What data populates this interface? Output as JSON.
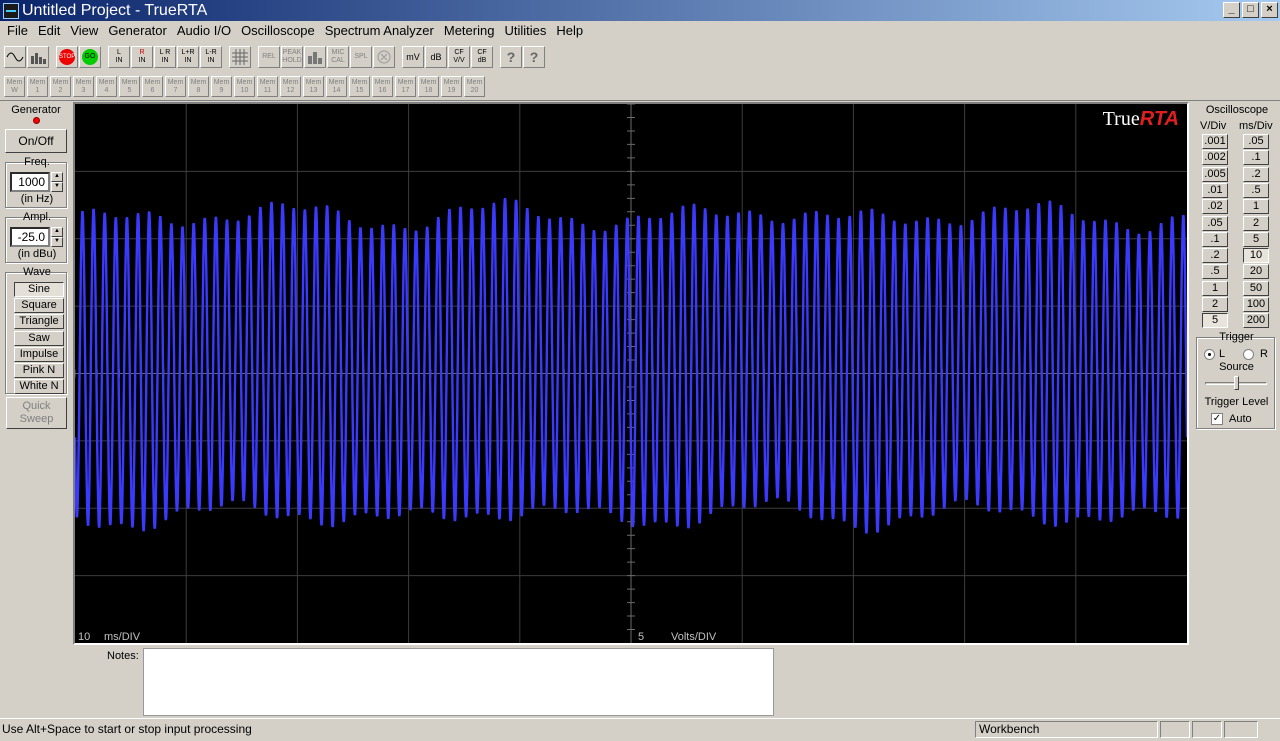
{
  "window": {
    "title": "Untitled Project - TrueRTA",
    "min": "_",
    "max": "□",
    "close": "×"
  },
  "menu": [
    "File",
    "Edit",
    "View",
    "Generator",
    "Audio I/O",
    "Oscilloscope",
    "Spectrum Analyzer",
    "Metering",
    "Utilities",
    "Help"
  ],
  "toolbar": {
    "stop": "STOP",
    "go": "GO",
    "l_in": [
      "L",
      "IN"
    ],
    "r_in": [
      "R",
      "IN"
    ],
    "lr_in": [
      "L R",
      "IN"
    ],
    "lpr_in": [
      "L+R",
      "IN"
    ],
    "lmr_in": [
      "L-R",
      "IN"
    ],
    "rel": "REL",
    "peak": [
      "PEAK",
      "HOLD"
    ],
    "mic": [
      "MIC",
      "CAL"
    ],
    "spl": "SPL",
    "mv": "mV",
    "db": "dB",
    "cf_vv": [
      "CF",
      "V/V"
    ],
    "cf_db": [
      "CF",
      "dB"
    ],
    "help": "?",
    "context_help": "?"
  },
  "memory": {
    "label": "Mem",
    "slots": [
      "W",
      "1",
      "2",
      "3",
      "4",
      "5",
      "6",
      "7",
      "8",
      "9",
      "10",
      "11",
      "12",
      "13",
      "14",
      "15",
      "16",
      "17",
      "18",
      "19",
      "20"
    ]
  },
  "generator": {
    "title": "Generator",
    "onoff": "On/Off",
    "freq_label": "Freq.",
    "freq_value": "1000",
    "freq_unit": "(in Hz)",
    "ampl_label": "Ampl.",
    "ampl_value": "-25.0",
    "ampl_unit": "(in dBu)",
    "wave_label": "Wave",
    "waves": [
      "Sine",
      "Square",
      "Triangle",
      "Saw",
      "Impulse",
      "Pink N",
      "White N"
    ],
    "selected_wave": "Sine",
    "quick_sweep": [
      "Quick",
      "Sweep"
    ]
  },
  "scope": {
    "brand_prefix": "True",
    "brand_suffix": "RTA",
    "time_value": "10",
    "time_unit": "ms/DIV",
    "volt_value": "5",
    "volt_unit": "Volts/DIV",
    "trace_color": "#3a3aff",
    "grid_color": "#3c3c3c"
  },
  "oscilloscope_panel": {
    "title": "Oscilloscope",
    "vdiv_label": "V/Div",
    "msdiv_label": "ms/Div",
    "vdiv": [
      ".001",
      ".002",
      ".005",
      ".01",
      ".02",
      ".05",
      ".1",
      ".2",
      ".5",
      "1",
      "2",
      "5"
    ],
    "msdiv": [
      ".05",
      ".1",
      ".2",
      ".5",
      "1",
      "2",
      "5",
      "10",
      "20",
      "50",
      "100",
      "200"
    ],
    "selected_vdiv": "5",
    "selected_msdiv": "10",
    "trigger_label": "Trigger",
    "source_l": "L",
    "source_r": "R",
    "source_label": "Source",
    "trigger_level_label": "Trigger Level",
    "auto_label": "Auto",
    "auto_checked": "✓"
  },
  "notes": {
    "label": "Notes:"
  },
  "status": {
    "text": "Use Alt+Space to start or stop input processing",
    "mode": "Workbench"
  }
}
